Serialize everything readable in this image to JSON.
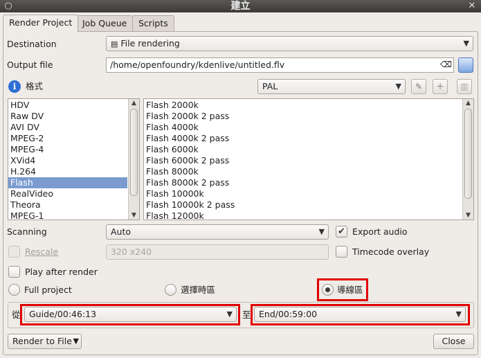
{
  "window": {
    "title": "建立"
  },
  "tabs": [
    {
      "label": "Render Project",
      "active": true
    },
    {
      "label": "Job Queue",
      "active": false
    },
    {
      "label": "Scripts",
      "active": false
    }
  ],
  "destination": {
    "label": "Destination",
    "value": "File rendering"
  },
  "output_file": {
    "label": "Output file",
    "value": "/home/openfoundry/kdenlive/untitled.flv"
  },
  "format": {
    "label": "格式",
    "profile": "PAL"
  },
  "formats": [
    "HDV",
    "Raw DV",
    "AVI DV",
    "MPEG-2",
    "MPEG-4",
    "XVid4",
    "H.264",
    "Flash",
    "RealVideo",
    "Theora",
    "MPEG-1"
  ],
  "selected_format": "Flash",
  "bitrates": [
    "Flash 2000k",
    "Flash 2000k 2 pass",
    "Flash 4000k",
    "Flash 4000k 2 pass",
    "Flash 6000k",
    "Flash 6000k 2 pass",
    "Flash 8000k",
    "Flash 8000k 2 pass",
    "Flash 10000k",
    "Flash 10000k 2 pass",
    "Flash 12000k"
  ],
  "scanning": {
    "label": "Scanning",
    "value": "Auto"
  },
  "export_audio": {
    "label": "Export audio",
    "checked": true
  },
  "rescale": {
    "label": "Rescale",
    "value": "320 x240",
    "checked": false
  },
  "timecode_overlay": {
    "label": "Timecode overlay",
    "checked": false
  },
  "play_after_render": {
    "label": "Play after render",
    "checked": false
  },
  "range": {
    "full_project": "Full project",
    "selected_zone": "選擇時區",
    "guide_zone": "導線區",
    "selected": "guide_zone"
  },
  "guides": {
    "from_label": "從",
    "from_value": "Guide/00:46:13",
    "to_label": "至",
    "to_value": "End/00:59:00"
  },
  "buttons": {
    "render": "Render to File",
    "close": "Close"
  },
  "colors": {
    "highlight": "#e00000",
    "selection": "#7b9bd0"
  }
}
